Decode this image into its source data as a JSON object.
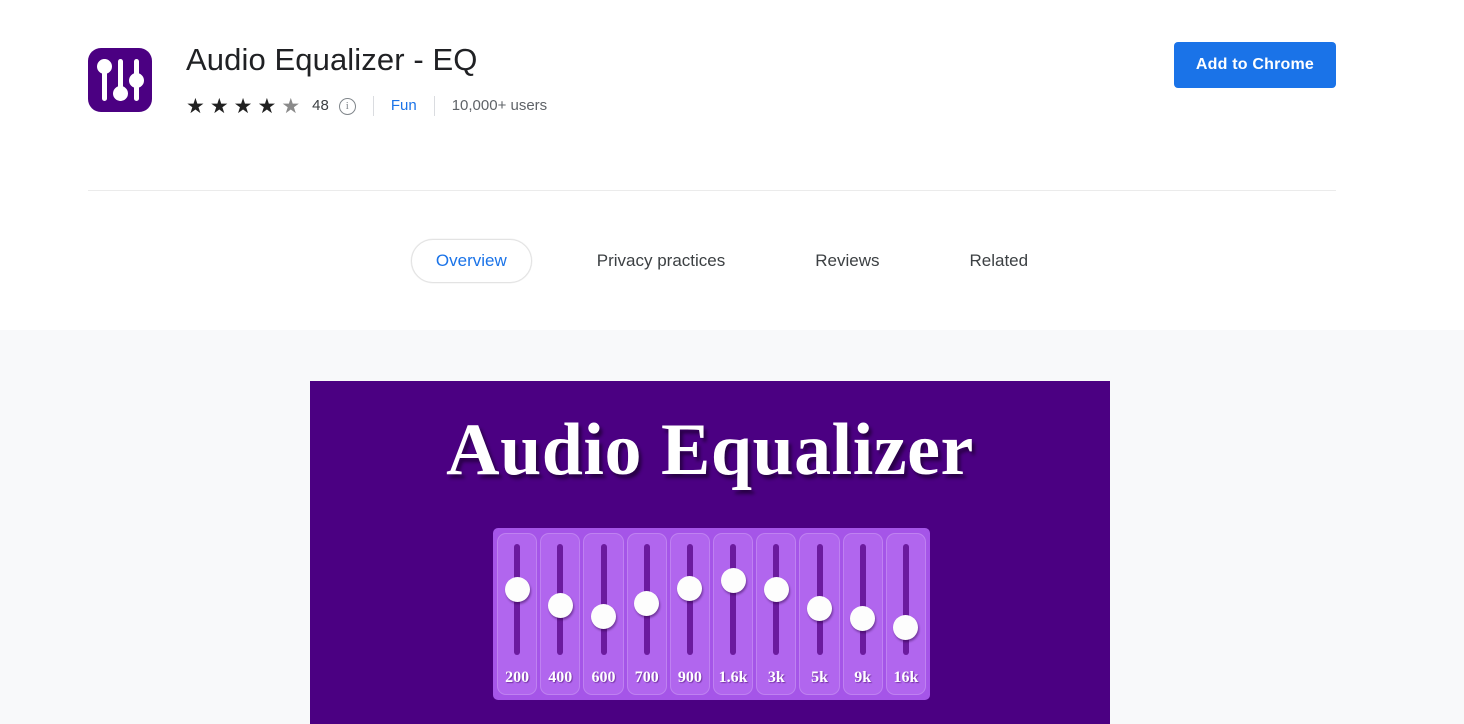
{
  "header": {
    "app_title": "Audio Equalizer - EQ",
    "icon_name": "equalizer-sliders-icon",
    "rating": {
      "filled_stars": 4,
      "total_stars": 5,
      "count_label": "48",
      "info_glyph": "i"
    },
    "category_label": "Fun",
    "users_label": "10,000+ users",
    "add_button_label": "Add to Chrome",
    "accent_color": "#1a73e8",
    "brand_color": "#4b0082"
  },
  "tabs": [
    {
      "label": "Overview",
      "active": true
    },
    {
      "label": "Privacy practices",
      "active": false
    },
    {
      "label": "Reviews",
      "active": false
    },
    {
      "label": "Related",
      "active": false
    }
  ],
  "banner": {
    "title": "Audio Equalizer",
    "background_color": "#4b0082",
    "bands": [
      {
        "label": "200",
        "knob_pct": 34
      },
      {
        "label": "400",
        "knob_pct": 50
      },
      {
        "label": "600",
        "knob_pct": 62
      },
      {
        "label": "700",
        "knob_pct": 48
      },
      {
        "label": "900",
        "knob_pct": 33
      },
      {
        "label": "1.6k",
        "knob_pct": 25
      },
      {
        "label": "3k",
        "knob_pct": 34
      },
      {
        "label": "5k",
        "knob_pct": 54
      },
      {
        "label": "9k",
        "knob_pct": 64
      },
      {
        "label": "16k",
        "knob_pct": 73
      }
    ]
  }
}
